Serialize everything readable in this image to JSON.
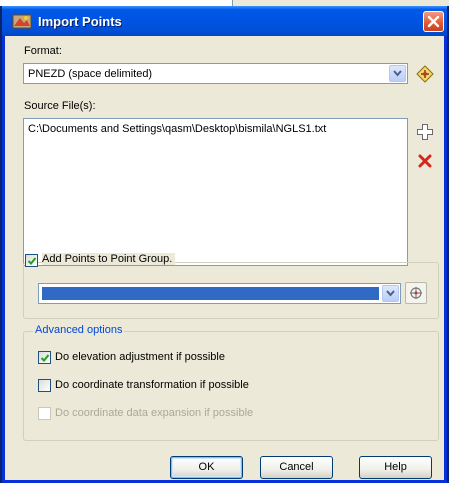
{
  "window": {
    "title": "Import Points"
  },
  "format": {
    "label": "Format:",
    "selected": "PNEZD (space delimited)"
  },
  "source": {
    "label": "Source File(s):",
    "files": [
      "C:\\Documents and Settings\\qasm\\Desktop\\bismila\\NGLS1.txt"
    ]
  },
  "point_group": {
    "checkbox_label": "Add Points to Point Group.",
    "checked": true,
    "selected": ""
  },
  "advanced": {
    "title": "Advanced options",
    "options": [
      {
        "label": "Do elevation adjustment if possible",
        "checked": true,
        "enabled": true
      },
      {
        "label": "Do coordinate transformation if possible",
        "checked": false,
        "enabled": true
      },
      {
        "label": "Do coordinate data expansion if possible",
        "checked": false,
        "enabled": false
      }
    ]
  },
  "buttons": {
    "ok": "OK",
    "cancel": "Cancel",
    "help": "Help"
  },
  "colors": {
    "title_bar": "#0054e3",
    "selection": "#316ac5",
    "group_title": "#0046d5",
    "close": "#e35c36"
  }
}
